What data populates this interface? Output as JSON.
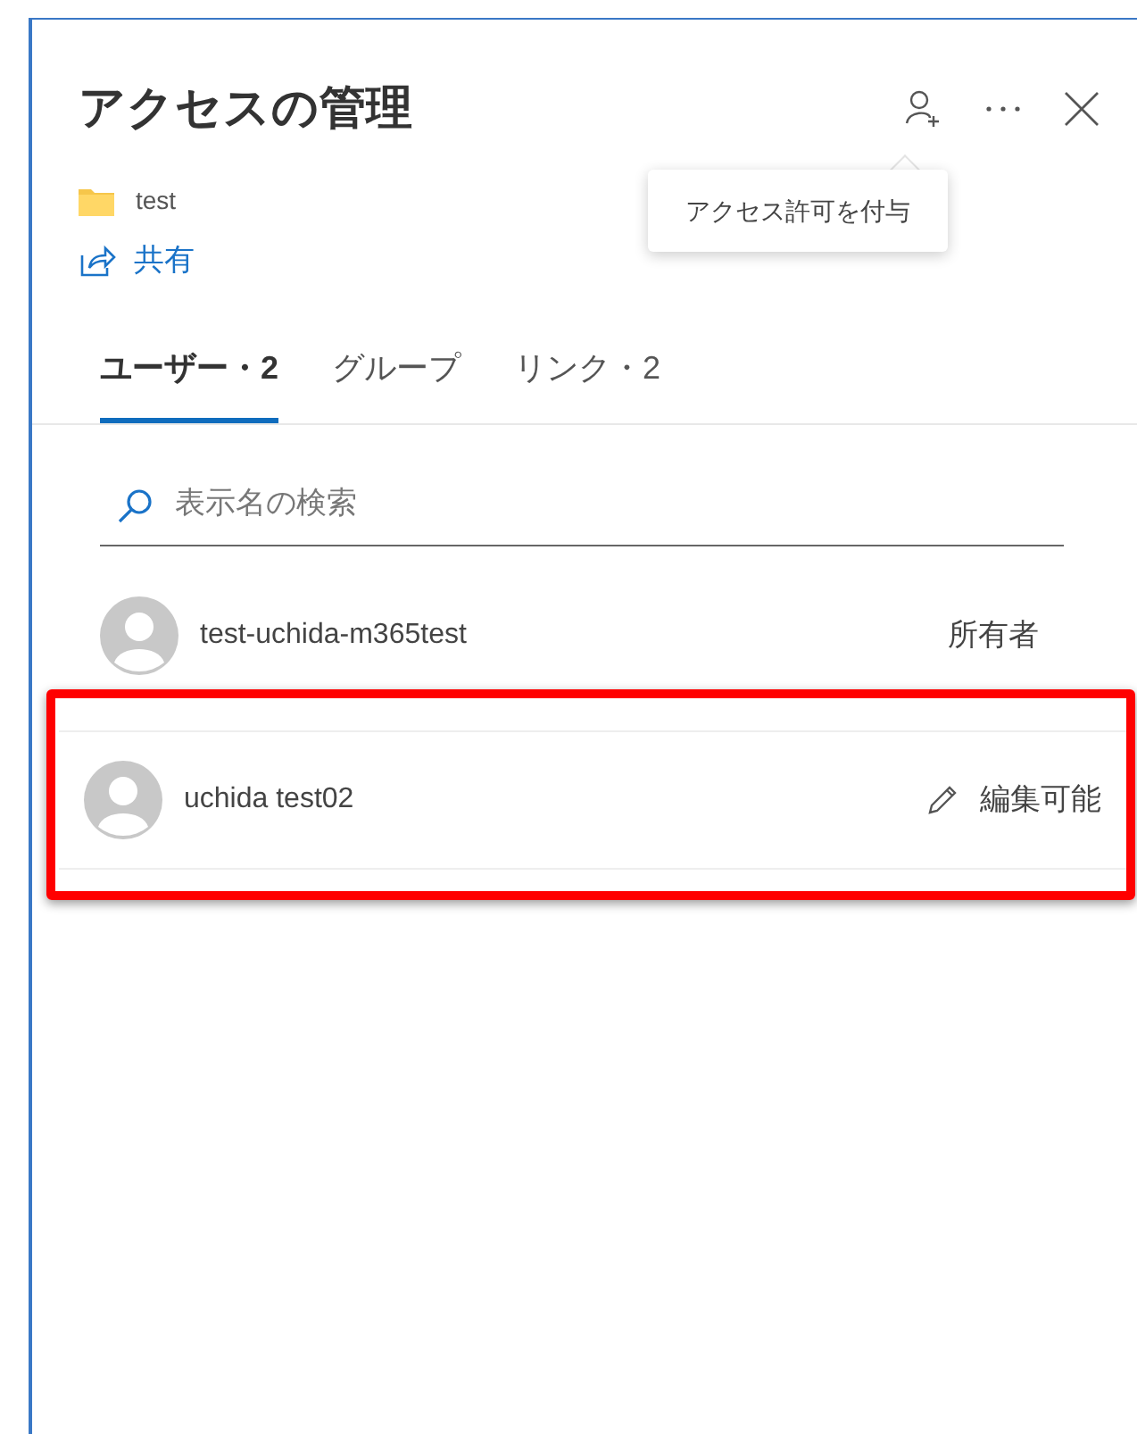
{
  "panel": {
    "title": "アクセスの管理",
    "item_name": "test",
    "share_link": "共有"
  },
  "tooltip": "アクセス許可を付与",
  "tabs": [
    {
      "label": "ユーザー・2",
      "selected": true
    },
    {
      "label": "グループ",
      "selected": false
    },
    {
      "label": "リンク・2",
      "selected": false
    }
  ],
  "search": {
    "placeholder": "表示名の検索"
  },
  "users": [
    {
      "name": "test-uchida-m365test",
      "role": "所有者",
      "kind": "owner",
      "highlighted": false
    },
    {
      "name": "uchida test02",
      "role": "編集可能",
      "kind": "editor",
      "highlighted": true
    }
  ]
}
